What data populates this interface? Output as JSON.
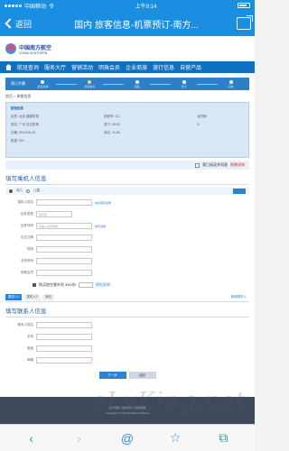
{
  "status": {
    "carrier": "中国移动",
    "network": "令",
    "time": "上午9:14",
    "battery_pct": ""
  },
  "nav": {
    "back_label": "返回",
    "title": "国内 旅客信息-机票预订-南方..."
  },
  "site": {
    "logo_text": "中国南方航空",
    "logo_sub": "CHINA SOUTHERN",
    "menu": [
      "首页",
      "航班查询",
      "服务大厅",
      "营销活动",
      "明珠会员",
      "企业商旅",
      "旅行信息",
      "自营产品"
    ]
  },
  "steps": {
    "label": "预订步骤",
    "items": [
      "航班选择",
      "旅客信息",
      "选座",
      "支付",
      "完成"
    ]
  },
  "crumb": "首页 > 旅客信息",
  "flight": {
    "title": "航班信息",
    "rows": [
      [
        "出发: 北京 首都机场",
        "航班号: CZ",
        "经济舱"
      ],
      [
        "到达: 广州 白云机场",
        "起飞: 08:00",
        "¥"
      ],
      [
        "日期: 2016-06-25",
        "到达: 11:05",
        ""
      ],
      [
        "机型: 321",
        "",
        ""
      ]
    ]
  },
  "notice": {
    "text": "我已阅读并同意",
    "link": "购票须知"
  },
  "passenger": {
    "section_title": "填写乘机人信息",
    "sub": {
      "type": "成人",
      "child": "儿童",
      "select_btn": ""
    },
    "fields": [
      {
        "label": "乘机人姓名",
        "value": "",
        "hint": "姓名填写说明"
      },
      {
        "label": "证件类型",
        "value": "身份证",
        "hint": ""
      },
      {
        "label": "证件号码",
        "value": "请输入证件号码",
        "hint": "填写说明"
      },
      {
        "label": "出生日期",
        "value": "",
        "hint": ""
      },
      {
        "label": "性别",
        "value": "",
        "hint": ""
      },
      {
        "label": "手机号码",
        "value": "",
        "hint": ""
      },
      {
        "label": "明珠会员",
        "value": "",
        "hint": ""
      }
    ],
    "insurance": "购买航空意外险 ¥30/份",
    "insurance_note": "保险说明"
  },
  "tabs": {
    "items": [
      "乘机人1",
      "乘机人2",
      "添加"
    ],
    "add": "新增乘机人"
  },
  "contact": {
    "section_title": "填写联系人信息",
    "fields": [
      {
        "label": "联系人姓名",
        "value": ""
      },
      {
        "label": "手机",
        "value": ""
      },
      {
        "label": "固话",
        "value": ""
      },
      {
        "label": "邮箱",
        "value": ""
      }
    ]
  },
  "buttons": {
    "next": "下一步",
    "prev": "返回"
  },
  "footer": {
    "line1": "关于南航 | 联系我们 | 网站地图",
    "line2": "Copyright © China Southern Airlines"
  },
  "toolbar": {
    "back": "‹",
    "forward": "›",
    "search": "@",
    "bookmark": "☆",
    "pages": "⧉"
  },
  "watermark": "eLvKing.net"
}
